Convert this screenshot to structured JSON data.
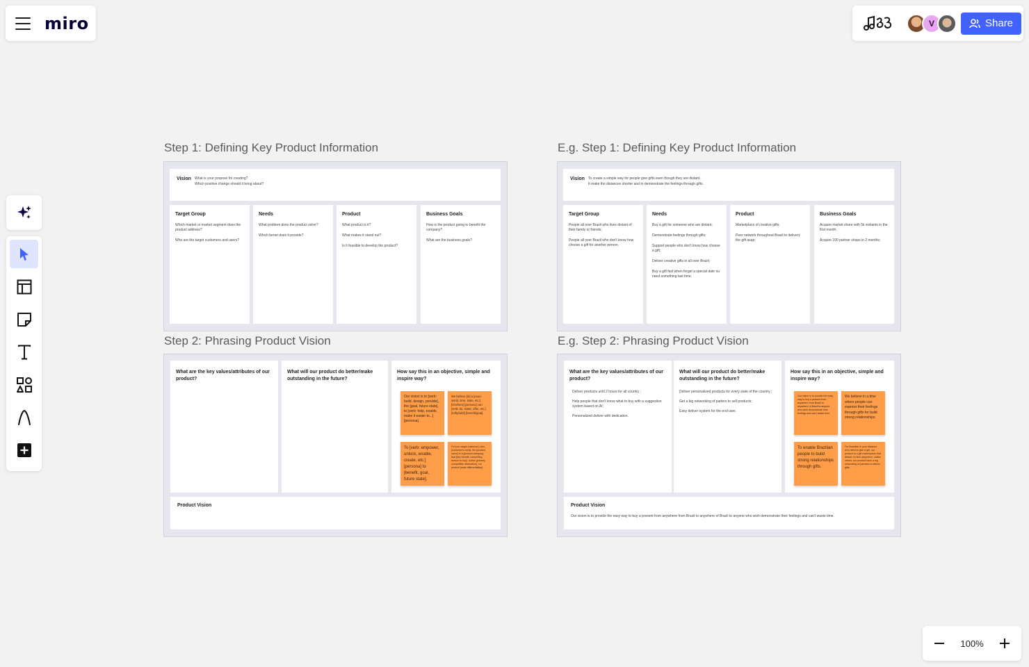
{
  "app": {
    "logo": "miro"
  },
  "collab": {
    "avatar_initial": "V",
    "share_label": "Share"
  },
  "zoom": {
    "level": "100%"
  },
  "icons": {
    "menu": "hamburger-icon",
    "reactions": "reactions-icon",
    "ai": "sparkle-icon",
    "select": "cursor-icon",
    "templates": "layout-icon",
    "sticky": "sticky-note-icon",
    "text": "text-icon",
    "shapes": "shapes-icon",
    "pen": "pen-icon",
    "more": "plus-square-icon",
    "zoom_out": "minus-icon",
    "zoom_in": "plus-icon"
  },
  "board": {
    "template_step1": {
      "title": "Step 1: Defining Key Product Information",
      "vision_label": "Vision",
      "vision_lines": [
        "What is your propose for creating?",
        "Which positive change should it bring about?"
      ],
      "columns": [
        {
          "title": "Target Group",
          "lines": [
            "Which market or market segment does the product address?",
            "Who are the target customers and users?"
          ]
        },
        {
          "title": "Needs",
          "lines": [
            "What problem does the product solve?",
            "Which benet does it provide?"
          ]
        },
        {
          "title": "Product",
          "lines": [
            "What product is it?",
            "What makes it stand out?",
            "Is it feasible to develop the product?"
          ]
        },
        {
          "title": "Business Goals",
          "lines": [
            "How is the product going to benefit the company?",
            "What are the business goals?"
          ]
        }
      ]
    },
    "template_step2": {
      "title": "Step 2: Phrasing Product Vision",
      "q1": "What are the key values/attributes of our product?",
      "q2": "What will our product do better/make outstanding in the future?",
      "q3": "How say this in an objective, simple and inspire way?",
      "stickies": [
        "Our vision is to [verb: build, design, provide], the [goal, future state], to [verb: help, enable, make it easier to...] [persona].",
        "We believe [in] a [noun: world, time, state, etc.] [in/where] [persona] can [verb: do, make, offer, etc.] [to/by/with] [benefit/goal].",
        "To [verb: empower, unlock, enable, create, etc.] [persona] to [benefit, goal, future state].",
        "For [our target customer], who [customer's need], the [product name] is a [product category] that [key benefit, compelling reason to buy]. Unlike [primary competitive alternative], our product [main differentiation]."
      ],
      "product_vision_label": "Product Vision"
    },
    "example_step1": {
      "title": "E.g. Step 1: Defining Key Product Information",
      "vision_label": "Vision",
      "vision_lines": [
        "To create a simple way for people give gifts even though they are distant.",
        "It make the distances shorter and to demonstrate the feelings through gifts."
      ],
      "columns": [
        {
          "title": "Target Group",
          "lines": [
            "People all over Brazil who lives distant of their family or friends;",
            "People all over Brazil who don't know how choose a gift for another person."
          ]
        },
        {
          "title": "Needs",
          "lines": [
            "Buy a gift for someone who are distant;",
            "Demonstrate feelings through gifts;",
            "Support people who don't know how choose a gift;",
            "Deliver creative gifts in all over Brazil;",
            "Buy a gift fast when forget a special date ou need something last time;"
          ]
        },
        {
          "title": "Product",
          "lines": [
            "Marketplace of creative gifts;",
            "Peer network throughout Brazil to delivery the gift asap;"
          ]
        },
        {
          "title": "Business Goals",
          "lines": [
            "Acquire market share with 5k visitants in the first month;",
            "Acquire 100 partner shops in 2 months;"
          ]
        }
      ]
    },
    "example_step2": {
      "title": "E.g. Step 2: Phrasing Product Vision",
      "q1": "What are the key values/attributes of our product?",
      "q1_answers": [
        "Deliver products until 2 hours for all country ;",
        "Help people that don't know what to buy with a suggestion system based on AI;",
        "Personalized deliver with dedication."
      ],
      "q2": "What will our product do better/make outstanding in the future?",
      "q2_answers": [
        "Deliver personalized products for every state of the country ;",
        "Get a big networking of parters to sell products;",
        "Easy deliver system for the end user."
      ],
      "q3": "How say this in an objective, simple and inspire way?",
      "stickies": [
        "Our vision is to provide the easy way to buy a present from anywhere from Brazil to anywhere of Brazil to anyone who wish demonstrate their feelings and can't waste time.",
        "We believe in a time where people can express their feelings through gifts for build strong relationships.",
        "To enable Brazilian people to build strong relationships through gifts.",
        "For Brazilian in your distance who need to give a gift, our product is a gift marketplace that deliver on time anywhere. Unlike others, our product have a big networking of partners to deliver gifts."
      ],
      "product_vision_label": "Product Vision",
      "product_vision_text": "Our vision is to provide the easy way to buy a present from anywhere from Brazil to anywhere of Brazil to anyone who wish demonstrate their feelings and can't waste time."
    }
  }
}
